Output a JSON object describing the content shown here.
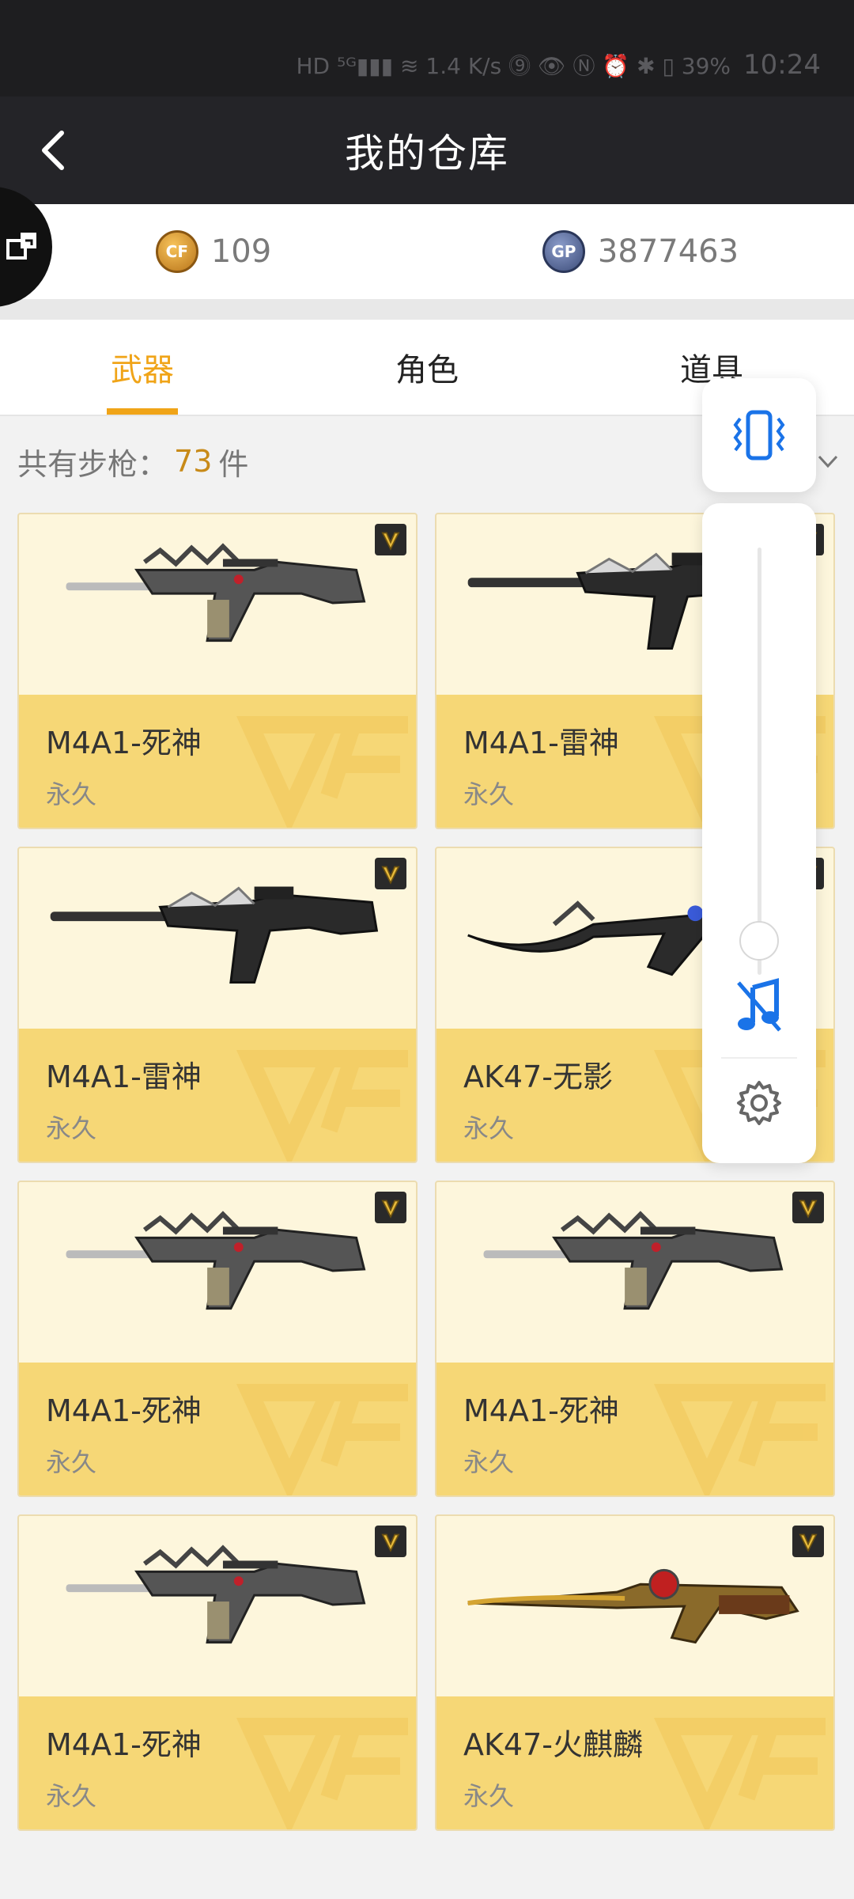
{
  "status_bar": {
    "icons": "HD  ⁵ᴳ▮▮▮  ≋  1.4 K/s  ⓽  👁  Ⓝ  ⏰  ✱  ▯  39%",
    "time": "10:24"
  },
  "header": {
    "title": "我的仓库"
  },
  "currency": {
    "cf": {
      "coin_label": "CF",
      "value": "109"
    },
    "gp": {
      "coin_label": "GP",
      "value": "3877463"
    }
  },
  "tabs": [
    {
      "label": "武器",
      "active": true
    },
    {
      "label": "角色",
      "active": false
    },
    {
      "label": "道具",
      "active": false
    }
  ],
  "count": {
    "prefix": "共有步枪：",
    "value": "73",
    "suffix": "件"
  },
  "items": [
    {
      "name": "M4A1-死神",
      "duration": "永久",
      "gun": "reaper"
    },
    {
      "name": "M4A1-雷神",
      "duration": "永久",
      "gun": "thor"
    },
    {
      "name": "M4A1-雷神",
      "duration": "永久",
      "gun": "thor"
    },
    {
      "name": "AK47-无影",
      "duration": "永久",
      "gun": "ak-shadow"
    },
    {
      "name": "M4A1-死神",
      "duration": "永久",
      "gun": "reaper"
    },
    {
      "name": "M4A1-死神",
      "duration": "永久",
      "gun": "reaper"
    },
    {
      "name": "M4A1-死神",
      "duration": "永久",
      "gun": "reaper"
    },
    {
      "name": "AK47-火麒麟",
      "duration": "永久",
      "gun": "ak-fire"
    }
  ],
  "volume_panel": {
    "level": 0.08
  },
  "colors": {
    "accent": "#f0a418",
    "card_bg": "#fdf6dc",
    "card_info": "#f6d776",
    "icon_blue": "#1a73e8"
  }
}
